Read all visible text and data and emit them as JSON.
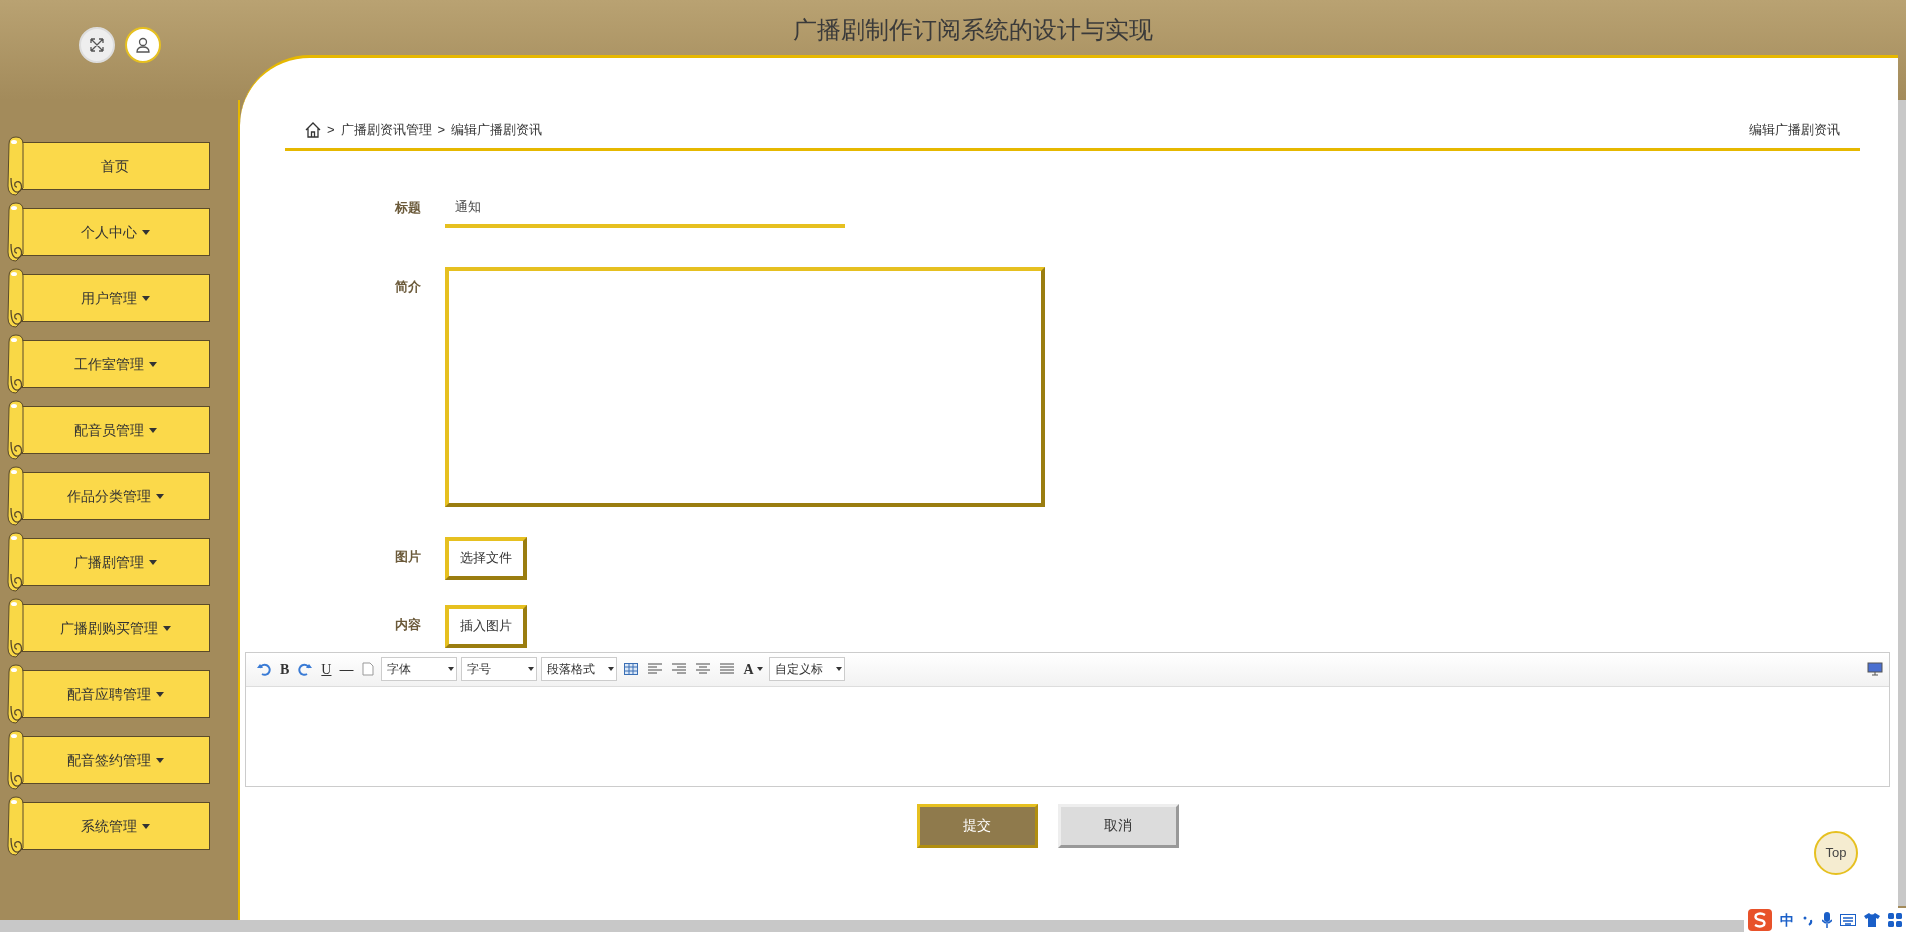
{
  "header": {
    "title": "广播剧制作订阅系统的设计与实现"
  },
  "sidebar": {
    "items": [
      {
        "label": "首页",
        "has_dropdown": false
      },
      {
        "label": "个人中心",
        "has_dropdown": true
      },
      {
        "label": "用户管理",
        "has_dropdown": true
      },
      {
        "label": "工作室管理",
        "has_dropdown": true
      },
      {
        "label": "配音员管理",
        "has_dropdown": true
      },
      {
        "label": "作品分类管理",
        "has_dropdown": true
      },
      {
        "label": "广播剧管理",
        "has_dropdown": true
      },
      {
        "label": "广播剧购买管理",
        "has_dropdown": true
      },
      {
        "label": "配音应聘管理",
        "has_dropdown": true
      },
      {
        "label": "配音签约管理",
        "has_dropdown": true
      },
      {
        "label": "系统管理",
        "has_dropdown": true
      }
    ]
  },
  "breadcrumb": {
    "items": [
      "广播剧资讯管理",
      "编辑广播剧资讯"
    ],
    "separator": ">",
    "page_title": "编辑广播剧资讯"
  },
  "form": {
    "title_label": "标题",
    "title_value": "通知",
    "summary_label": "简介",
    "image_label": "图片",
    "image_button": "选择文件",
    "content_label": "内容",
    "content_button": "插入图片"
  },
  "editor": {
    "toolbar": [
      {
        "kind": "icon"
      },
      {
        "kind": "text",
        "text": "B"
      },
      {
        "kind": "icon"
      },
      {
        "kind": "text",
        "text": "U"
      },
      {
        "kind": "text",
        "text": "—"
      },
      {
        "kind": "icon"
      },
      {
        "kind": "select",
        "text": "字体"
      },
      {
        "kind": "select",
        "text": "字号"
      },
      {
        "kind": "select",
        "text": "段落格式"
      },
      {
        "kind": "icon"
      },
      {
        "kind": "icon"
      },
      {
        "kind": "icon"
      },
      {
        "kind": "icon"
      },
      {
        "kind": "icon"
      },
      {
        "kind": "text",
        "text": "A"
      },
      {
        "kind": "select",
        "text": "自定义标"
      }
    ]
  },
  "actions": {
    "submit": "提交",
    "cancel": "取消"
  },
  "back_to_top": "Top",
  "ime_bar": {
    "mode": "中"
  }
}
